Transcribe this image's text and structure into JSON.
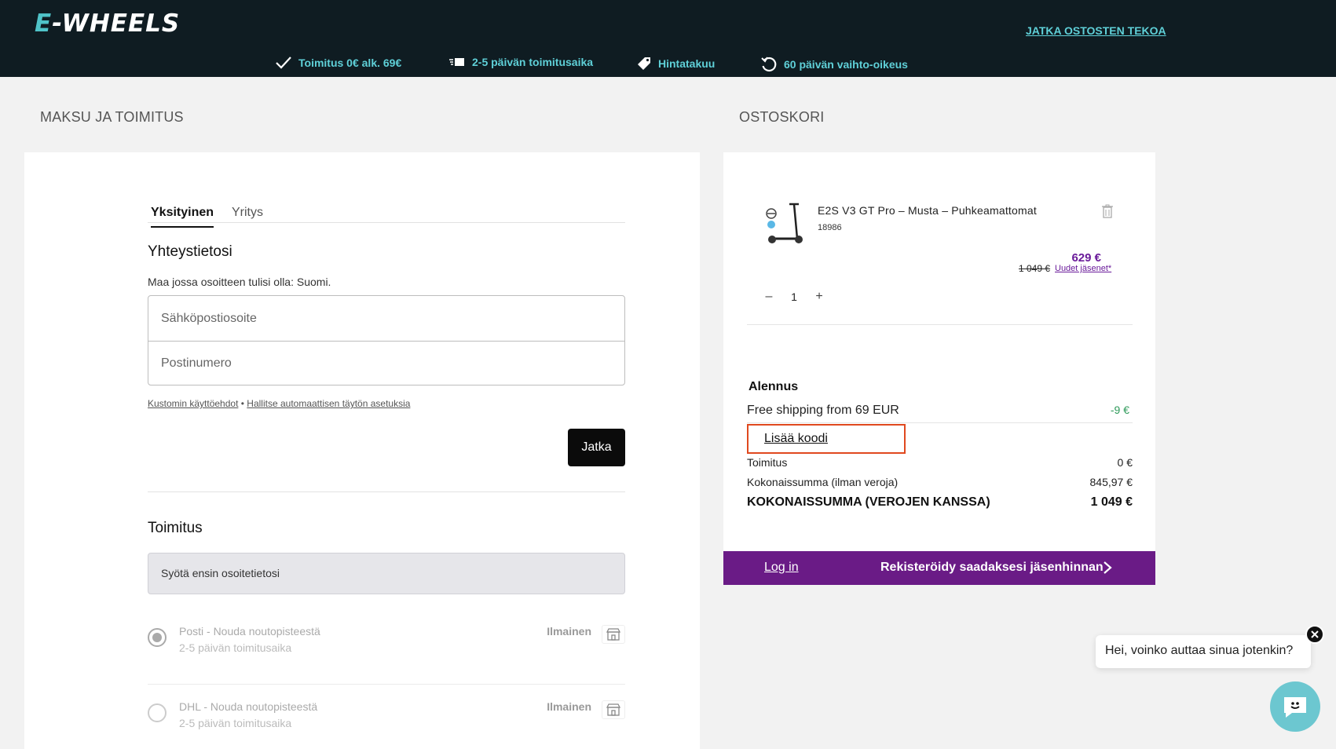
{
  "header": {
    "logo_prefix": "E",
    "logo_rest": "-WHEELS",
    "continue_link": "JATKA OSTOSTEN TEKOA",
    "usps": [
      {
        "icon": "checkmark-icon",
        "label": "Toimitus 0€ alk. 69€"
      },
      {
        "icon": "delivery-truck-icon",
        "label": "2-5 päivän toimitusaika"
      },
      {
        "icon": "price-tag-icon",
        "label": "Hintatakuu"
      },
      {
        "icon": "return-arrow-icon",
        "label": "60 päivän vaihto-oikeus"
      }
    ],
    "accent_color": "#5fd0d8",
    "background_color": "#0f1c22"
  },
  "left": {
    "section_title": "MAKSU JA TOIMITUS",
    "tabs": [
      {
        "label": "Yksityinen",
        "active": true
      },
      {
        "label": "Yritys",
        "active": false
      }
    ],
    "contact_heading": "Yhteystietosi",
    "country_note": "Maa jossa osoitteen tulisi olla: Suomi.",
    "email_placeholder": "Sähköpostiosoite",
    "postal_placeholder": "Postinumero",
    "terms_link": "Kustomin käyttöehdot",
    "legal_separator": "•",
    "autofill_link": "Hallitse automaattisen täytön asetuksia",
    "continue_button": "Jatka",
    "delivery_heading": "Toimitus",
    "delivery_info": "Syötä ensin osoitetietosi",
    "shipping_options": [
      {
        "name": "Posti - Nouda noutopisteestä",
        "time": "2-5 päivän toimitusaika",
        "price": "Ilmainen",
        "selected": true
      },
      {
        "name": "DHL - Nouda noutopisteestä",
        "time": "2-5 päivän toimitusaika",
        "price": "Ilmainen",
        "selected": false
      }
    ]
  },
  "cart": {
    "section_title": "OSTOSKORI",
    "product": {
      "name": "E2S V3 GT Pro – Musta – Puhkeamattomat",
      "sku": "18986",
      "price_now": "629 €",
      "price_old": "1 049 €",
      "member_link": "Uudet jäsenet*",
      "quantity": "1",
      "minus": "–",
      "plus": "+"
    },
    "discount_title": "Alennus",
    "free_shipping_label": "Free shipping from 69 EUR",
    "free_shipping_value": "-9 €",
    "add_code": "Lisää koodi",
    "shipping_label": "Toimitus",
    "shipping_value": "0 €",
    "subtotal_label": "Kokonaissumma (ilman veroja)",
    "subtotal_value": "845,97 €",
    "total_label": "KOKONAISSUMMA (VEROJEN KANSSA)",
    "total_value": "1 049 €",
    "member_price_color": "#6a1b9a",
    "discount_color": "#2e9a5a"
  },
  "promo_bar": {
    "login": "Log in",
    "register": "Rekisteröidy saadaksesi jäsenhinnan",
    "color": "#6a1b86"
  },
  "chat": {
    "message": "Hei, voinko auttaa sinua jotenkin?",
    "button_color": "#6cc7d0"
  }
}
